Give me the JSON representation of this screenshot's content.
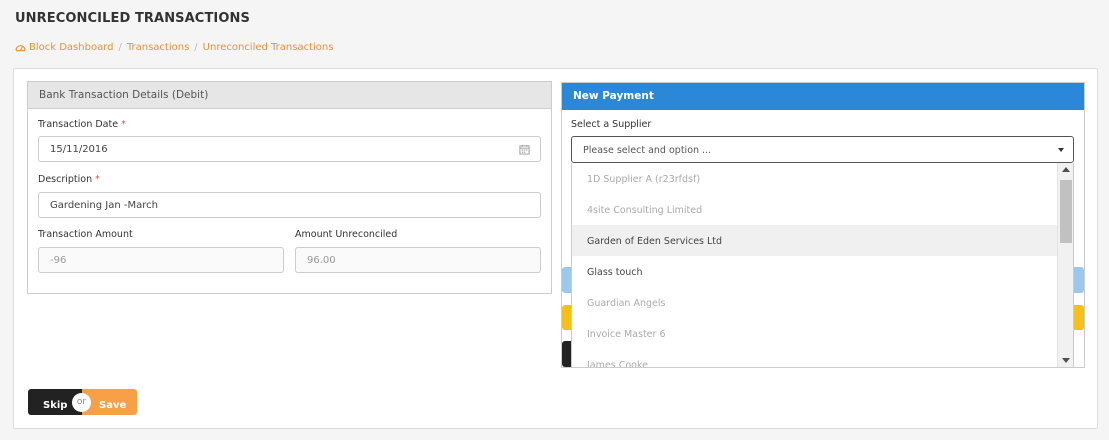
{
  "page": {
    "title": "UNRECONCILED TRANSACTIONS"
  },
  "breadcrumb": {
    "items": [
      "Block Dashboard",
      "Transactions",
      "Unreconciled Transactions"
    ],
    "separator": "/"
  },
  "bank_panel": {
    "title": "Bank Transaction Details (Debit)",
    "transaction_date_label": "Transaction Date",
    "transaction_date_value": "15/11/2016",
    "description_label": "Description",
    "description_value": "Gardening Jan -March",
    "amount_label": "Transaction Amount",
    "amount_value": "-96",
    "unreconciled_label": "Amount Unreconciled",
    "unreconciled_value": "96.00",
    "required_mark": "*"
  },
  "payment_panel": {
    "title": "New Payment",
    "supplier_label": "Select a Supplier",
    "supplier_placeholder": "Please select and option ...",
    "options": [
      {
        "label": "1D Supplier A (r23rfdsf)",
        "state": "disabled"
      },
      {
        "label": "4site Consulting Limited",
        "state": "disabled"
      },
      {
        "label": "Garden of Eden Services Ltd",
        "state": "highlight"
      },
      {
        "label": "Glass touch",
        "state": "enabled"
      },
      {
        "label": "Guardian Angels",
        "state": "disabled"
      },
      {
        "label": "Invoice Master 6",
        "state": "disabled"
      },
      {
        "label": "James Cooke",
        "state": "disabled"
      }
    ]
  },
  "actions": {
    "skip_label": "Skip",
    "or_label": "or",
    "save_label": "Save"
  },
  "colors": {
    "accent_orange": "#e8923a",
    "primary_blue": "#2b88d8",
    "save_orange": "#f7a047",
    "warning_yellow": "#f5c119"
  }
}
